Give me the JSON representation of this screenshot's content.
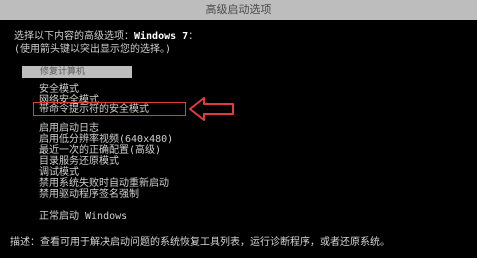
{
  "title": "高级启动选项",
  "intro": {
    "line1_prefix": "选择以下内容的高级选项：",
    "os_name": "Windows 7",
    "line1_suffix": "：",
    "line2": "(使用箭头键以突出显示您的选择。)"
  },
  "selected_option": "修复计算机",
  "options": [
    "安全模式",
    "网络安全模式",
    "带命令提示符的安全模式",
    "启用启动日志",
    "启用低分辨率视频(640x480)",
    "最近一次的正确配置(高级)",
    "目录服务还原模式",
    "调试模式",
    "禁用系统失败时自动重新启动",
    "禁用驱动程序签名强制",
    "正常启动 Windows"
  ],
  "highlighted_option_index": 2,
  "footer": {
    "label": "描述：",
    "text": "查看可用于解决启动问题的系统恢复工具列表，运行诊断程序，或者还原系统。"
  },
  "colors": {
    "background": "#000000",
    "title_bar": "#bdbdbd",
    "annotation_red": "#e23b3b"
  }
}
